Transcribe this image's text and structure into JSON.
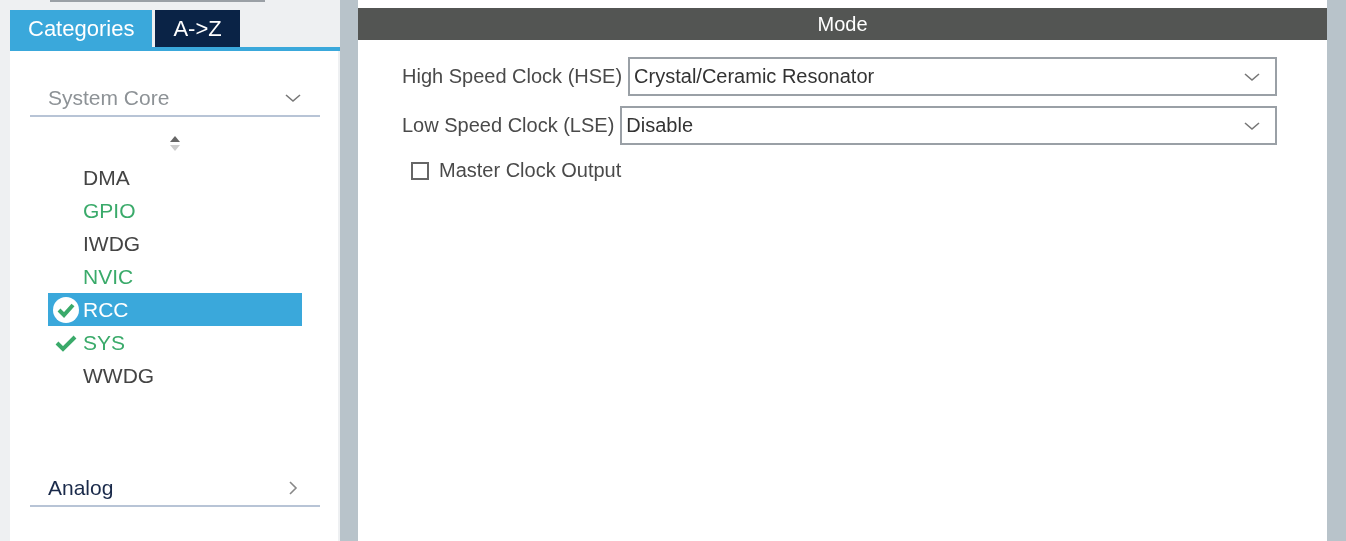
{
  "tabs": [
    {
      "label": "Categories",
      "selected": true
    },
    {
      "label": "A->Z",
      "selected": false
    }
  ],
  "category": {
    "label": "System Core",
    "expanded": true
  },
  "items": [
    {
      "label": "DMA",
      "configured": false,
      "checked": false,
      "selected": false
    },
    {
      "label": "GPIO",
      "configured": true,
      "checked": false,
      "selected": false
    },
    {
      "label": "IWDG",
      "configured": false,
      "checked": false,
      "selected": false
    },
    {
      "label": "NVIC",
      "configured": true,
      "checked": false,
      "selected": false
    },
    {
      "label": "RCC",
      "configured": true,
      "checked": true,
      "selected": true
    },
    {
      "label": "SYS",
      "configured": true,
      "checked": true,
      "selected": false
    },
    {
      "label": "WWDG",
      "configured": false,
      "checked": false,
      "selected": false
    }
  ],
  "next_category": {
    "label": "Analog",
    "expanded": false
  },
  "mode": {
    "title": "Mode",
    "fields": [
      {
        "label": "High Speed Clock (HSE)",
        "value": "Crystal/Ceramic Resonator"
      },
      {
        "label": "Low Speed Clock (LSE)",
        "value": "Disable"
      }
    ],
    "checkbox": {
      "label": "Master Clock Output",
      "checked": false
    }
  }
}
